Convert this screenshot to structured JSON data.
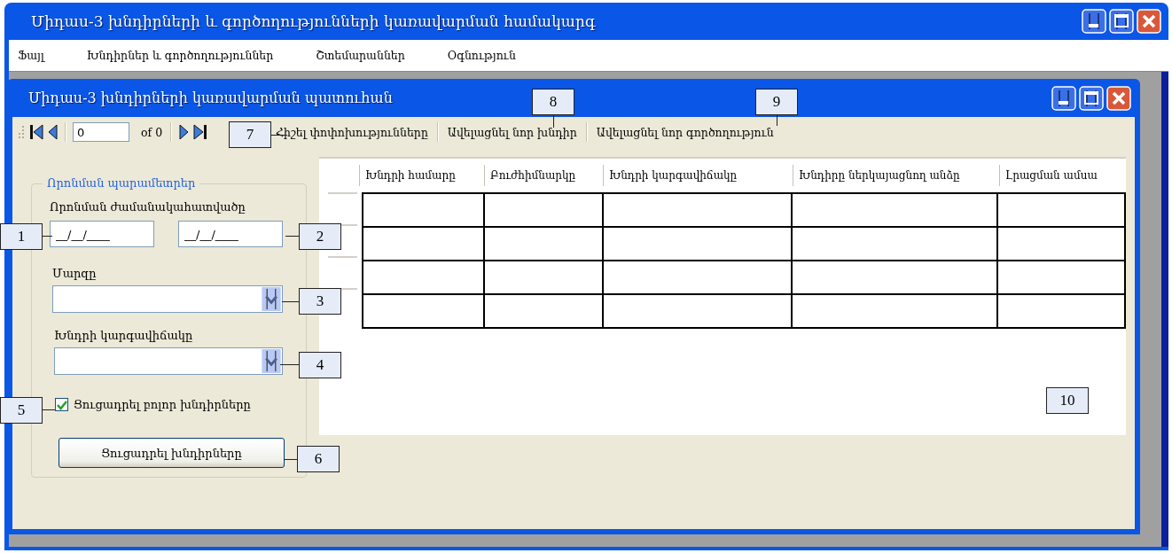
{
  "window": {
    "title": "Միդաս-3 խնդիրների և գործողությունների կառավարման համակարգ"
  },
  "menu": [
    {
      "label": "Ֆայլ"
    },
    {
      "label": "Խնդիրներ և գործողություններ"
    },
    {
      "label": "Շտեմարաններ"
    },
    {
      "label": "Օգնություն"
    }
  ],
  "child_window": {
    "title": "Միդաս-3 խնդիրների կառավարման պատուհան"
  },
  "toolbar": {
    "record": "0",
    "total": "of 0",
    "actions": [
      "Հիշել փոփոխությունները",
      "Ավելացնել նոր խնդիր",
      "Ավելացնել նոր գործողություն"
    ]
  },
  "search": {
    "title": "Որոնման պարամետրեր",
    "period_label": "Որոնման ժամանակահատվածը",
    "date_from": "__/__/____",
    "date_to": "__/__/____",
    "region_label": "Մարզը",
    "status_label": "Խնդրի կարգավիճակը",
    "show_all": {
      "label": "Ցուցադրել բոլոր խնդիրները",
      "checked": true
    },
    "button": "Ցուցադրել խնդիրները"
  },
  "grid": {
    "columns": [
      "Խնդրի համարը",
      "Բուժհիմնարկը",
      "Խնդրի կարգավիճակը",
      "Խնդիրը ներկայացնող անձը",
      "Լրացման ամսա"
    ],
    "rows": [
      {
        "selected": false
      },
      {
        "selected": false
      },
      {
        "selected": false
      },
      {
        "selected": false
      }
    ]
  },
  "callouts": [
    "1",
    "2",
    "3",
    "4",
    "5",
    "6",
    "7",
    "8",
    "9",
    "10"
  ]
}
